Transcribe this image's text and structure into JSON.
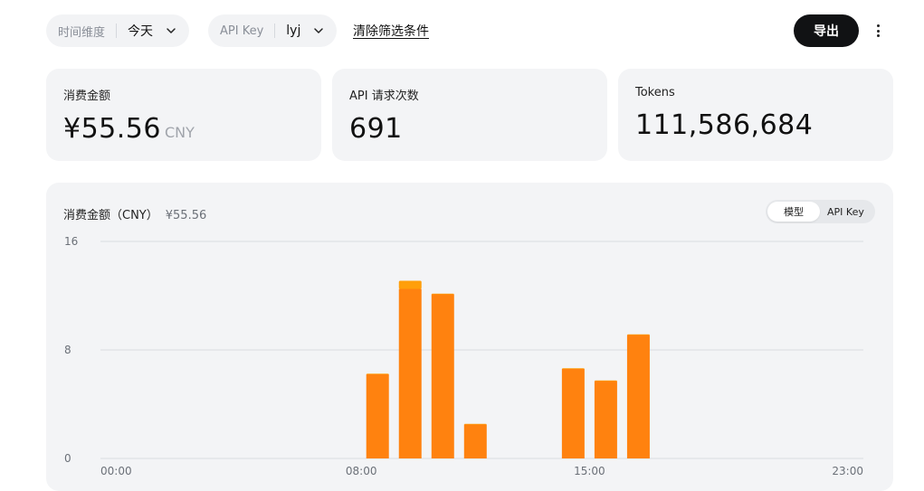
{
  "filters": {
    "time": {
      "label": "时间维度",
      "value": "今天"
    },
    "api_key": {
      "label": "API Key",
      "value": "lyj"
    },
    "clear_label": "清除筛选条件"
  },
  "header": {
    "export_label": "导出",
    "more_icon": "more-vertical-icon"
  },
  "stats": {
    "spend": {
      "title": "消费金额",
      "value": "¥55.56",
      "unit": "CNY"
    },
    "requests": {
      "title": "API 请求次数",
      "value": "691"
    },
    "tokens": {
      "title": "Tokens",
      "value": "111,586,684"
    }
  },
  "chart_panel": {
    "title": "消费金额（CNY）",
    "total": "¥55.56",
    "toggle": {
      "options": [
        "模型",
        "API Key"
      ],
      "selected": "模型"
    }
  },
  "colors": {
    "bar_main": "#ff820f",
    "bar_top": "#ff9f0a",
    "grid": "#d9dce0",
    "accent_dark": "#111214"
  },
  "chart_data": {
    "type": "bar",
    "stacked": true,
    "x_tick_labels": [
      "00:00",
      "08:00",
      "15:00",
      "23:00"
    ],
    "y_ticks": [
      0,
      8,
      16
    ],
    "ylim": [
      0,
      16
    ],
    "x": [
      8,
      9,
      10,
      11,
      14,
      15,
      16
    ],
    "series": [
      {
        "values": [
          6.2,
          12.5,
          12.1,
          2.5,
          6.6,
          5.7,
          9.1
        ]
      },
      {
        "values": [
          0.05,
          0.6,
          0.05,
          0.05,
          0.05,
          0.05,
          0.05
        ]
      }
    ],
    "grid": true
  }
}
